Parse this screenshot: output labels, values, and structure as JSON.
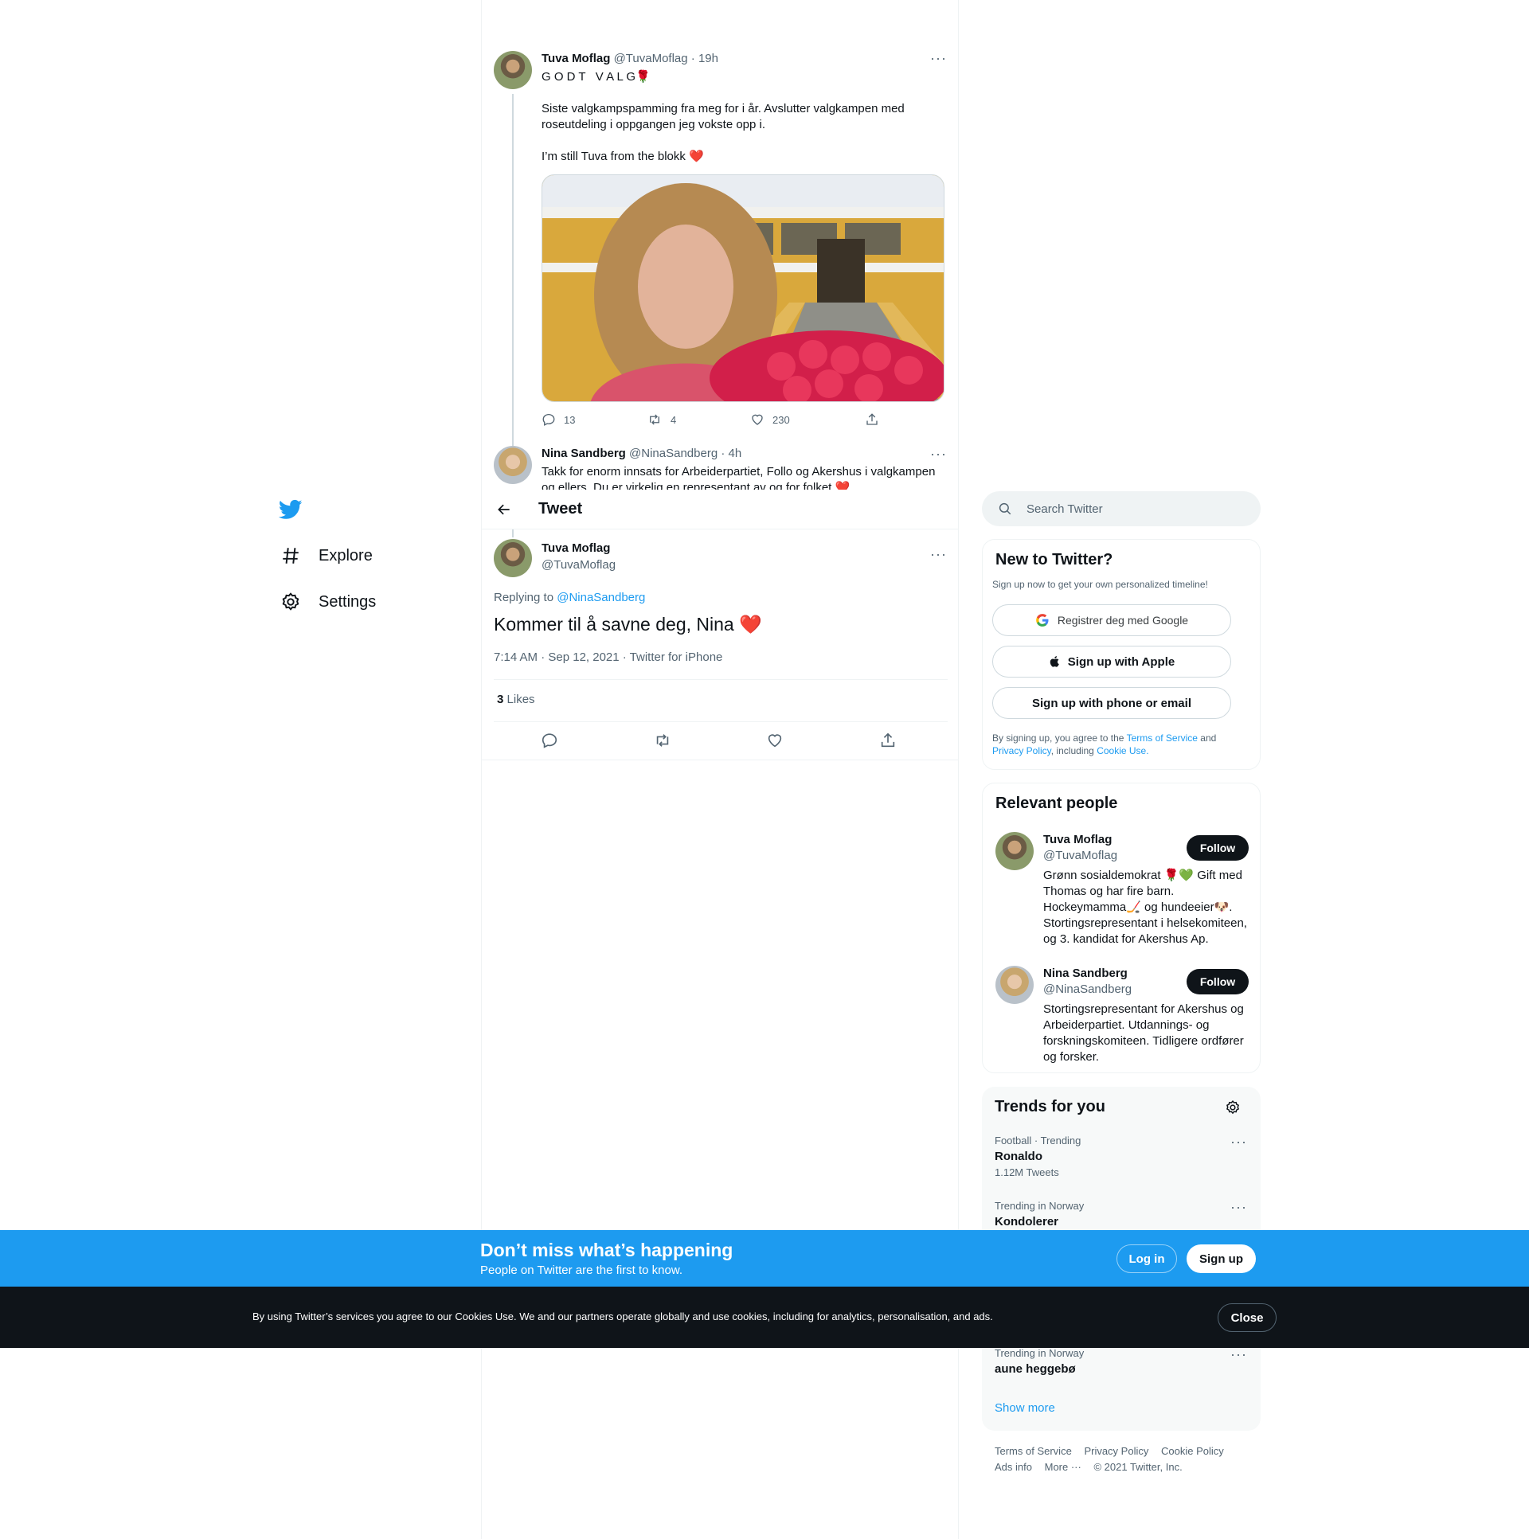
{
  "nav": {
    "explore": "Explore",
    "settings": "Settings"
  },
  "thread": {
    "tweet1": {
      "name": "Tuva Moflag",
      "handle": "@TuvaMoflag",
      "sep": "·",
      "time": "19h",
      "line1": "G O D T   V A L G🌹",
      "line2a": "Siste valgkampspamming fra meg for i år. Avslutter valgkampen med",
      "line2b": "roseutdeling i oppgangen jeg vokste opp i.",
      "line3": "I’m still Tuva from the blokk ❤️",
      "replies": "13",
      "retweets": "4",
      "likes": "230"
    },
    "tweet2": {
      "name": "Nina Sandberg",
      "handle": "@NinaSandberg",
      "sep": "·",
      "time": "4h",
      "line1": "Takk for enorm innsats for Arbeiderpartiet, Follo og Akershus i valgkampen",
      "line2": "og ellers. Du er virkelig en representant av og for folket ❤️"
    }
  },
  "header": {
    "title": "Tweet"
  },
  "main_tweet": {
    "name": "Tuva Moflag",
    "handle": "@TuvaMoflag",
    "replying_prefix": "Replying to",
    "replying_handle": "@NinaSandberg",
    "text": "Kommer til å savne deg, Nina ❤️",
    "meta": "7:14 AM · Sep 12, 2021 · Twitter for iPhone",
    "likes_count": "3",
    "likes_label": "Likes"
  },
  "search": {
    "placeholder": "Search Twitter"
  },
  "new_to_twitter": {
    "title": "New to Twitter?",
    "subtitle": "Sign up now to get your own personalized timeline!",
    "google": "Registrer deg med Google",
    "apple": "Sign up with Apple",
    "phone": "Sign up with phone or email",
    "legal_1": "By signing up, you agree to the",
    "tos": "Terms of Service",
    "and": "and",
    "privacy": "Privacy Policy",
    "including": ", including",
    "cookie": "Cookie Use."
  },
  "relevant": {
    "title": "Relevant people",
    "people": [
      {
        "name": "Tuva Moflag",
        "handle": "@TuvaMoflag",
        "follow": "Follow",
        "bio": [
          "Grønn sosialdemokrat 🌹💚 Gift med",
          "Thomas og har fire barn.",
          "Hockeymamma🏒 og hundeeier🐶.",
          "Stortingsrepresentant i helsekomiteen,",
          "og 3. kandidat for Akershus Ap."
        ]
      },
      {
        "name": "Nina Sandberg",
        "handle": "@NinaSandberg",
        "follow": "Follow",
        "bio": [
          "Stortingsrepresentant for Akershus og",
          "Arbeiderpartiet. Utdannings- og",
          "forskningskomiteen. Tidligere ordfører",
          "og forsker."
        ]
      }
    ]
  },
  "trends": {
    "title": "Trends for you",
    "items": [
      {
        "category": "Football · Trending",
        "name": "Ronaldo",
        "count": "1.12M Tweets"
      },
      {
        "category": "Trending in Norway",
        "name": "Kondolerer",
        "count": ""
      },
      {
        "category": "Trending in Norway",
        "name": "aune heggebø",
        "count": ""
      }
    ],
    "show_more": "Show more"
  },
  "footer": {
    "tos": "Terms of Service",
    "privacy": "Privacy Policy",
    "cookie": "Cookie Policy",
    "ads": "Ads info",
    "more": "More ···",
    "copyright": "© 2021 Twitter, Inc."
  },
  "banner": {
    "title": "Don’t miss what’s happening",
    "subtitle": "People on Twitter are the first to know.",
    "login": "Log in",
    "signup": "Sign up"
  },
  "cookie_bar": {
    "text": "By using Twitter’s services you agree to our Cookies Use. We and our partners operate globally and use cookies, including for analytics, personalisation, and ads.",
    "close": "Close"
  },
  "colors": {
    "accent": "#1d9bf0",
    "banner": "#1d9bf0",
    "cookie_bg": "#0f1419",
    "heart": "#e0245e"
  }
}
